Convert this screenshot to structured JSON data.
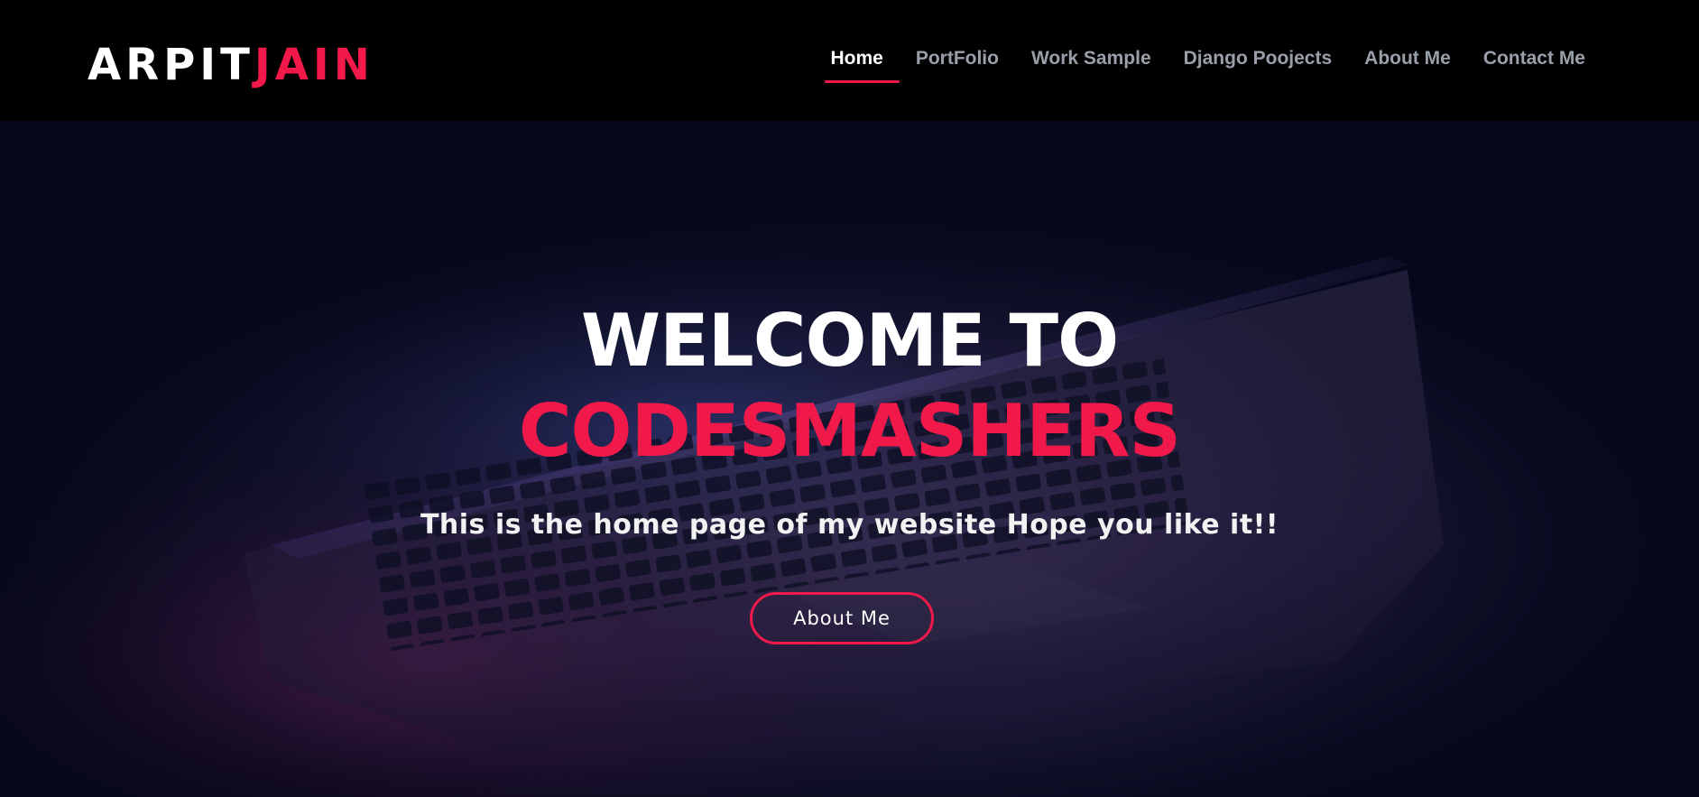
{
  "brand": {
    "first": "ARPIT",
    "last": "JAIN"
  },
  "nav": {
    "items": [
      {
        "label": "Home",
        "active": true
      },
      {
        "label": "PortFolio",
        "active": false
      },
      {
        "label": "Work Sample",
        "active": false
      },
      {
        "label": "Django Poojects",
        "active": false
      },
      {
        "label": "About Me",
        "active": false
      },
      {
        "label": "Contact Me",
        "active": false
      }
    ]
  },
  "hero": {
    "title_line1": "WELCOME TO",
    "title_line2": "CODESMASHERS",
    "subtitle": "This is the home page of my website Hope you like it!!",
    "button_label": "About Me",
    "background_image": "laptop-keyboard-photo"
  },
  "colors": {
    "accent": "#f0194a",
    "header_bg": "#000000",
    "hero_bg": "#05081a",
    "nav_inactive": "#9aa0aa",
    "text_primary": "#ffffff"
  }
}
